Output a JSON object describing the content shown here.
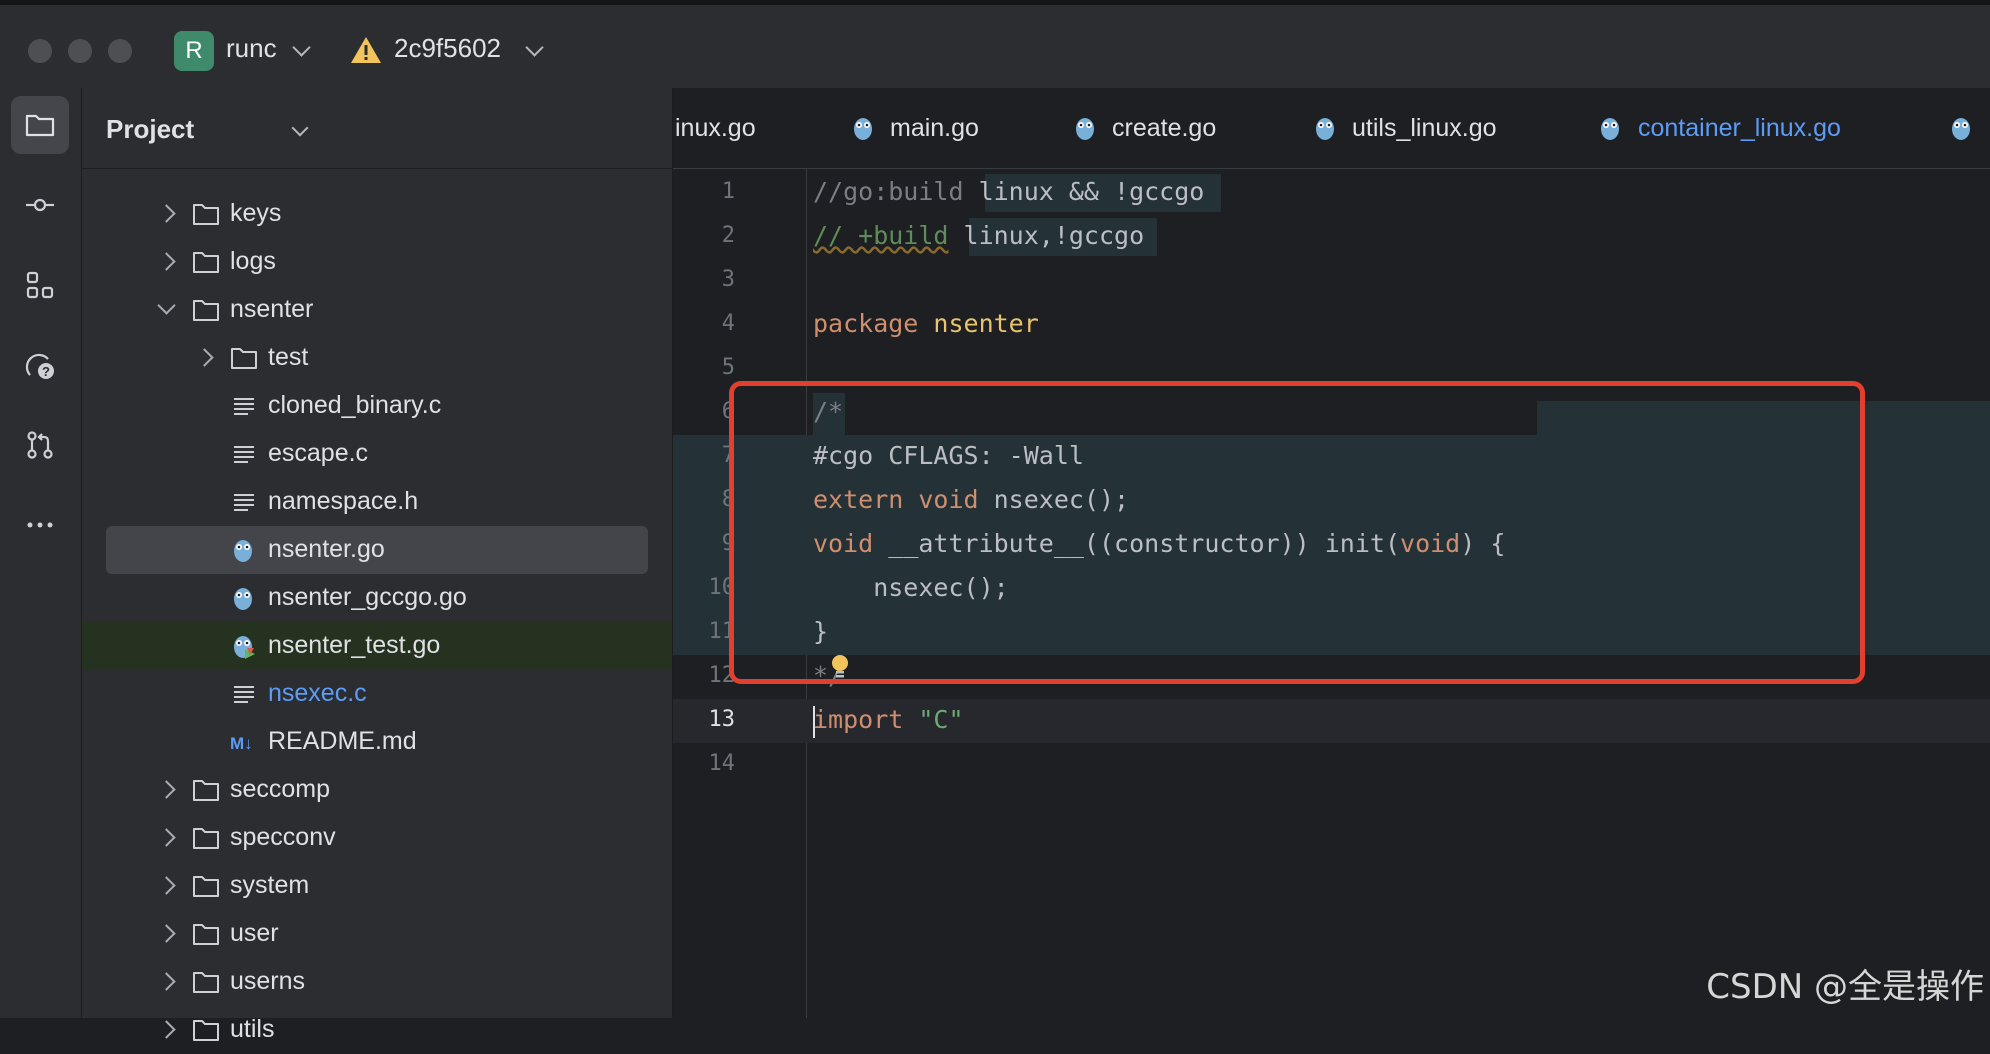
{
  "window": {
    "project_badge": "R",
    "project_name": "runc",
    "commit": "2c9f5602"
  },
  "toolstrip": {
    "icons": [
      "project-folder-icon",
      "commit-icon",
      "structure-icon",
      "services-icon",
      "pull-requests-icon",
      "more-icon"
    ]
  },
  "project_panel": {
    "title": "Project",
    "items": [
      {
        "label": "keys",
        "type": "folder",
        "expanded": false
      },
      {
        "label": "logs",
        "type": "folder",
        "expanded": false
      },
      {
        "label": "nsenter",
        "type": "folder",
        "expanded": true
      },
      {
        "label": "test",
        "type": "folder",
        "expanded": false
      },
      {
        "label": "cloned_binary.c",
        "type": "c-file"
      },
      {
        "label": "escape.c",
        "type": "c-file"
      },
      {
        "label": "namespace.h",
        "type": "c-file"
      },
      {
        "label": "nsenter.go",
        "type": "go-file",
        "selected": true
      },
      {
        "label": "nsenter_gccgo.go",
        "type": "go-file"
      },
      {
        "label": "nsenter_test.go",
        "type": "go-test-file"
      },
      {
        "label": "nsexec.c",
        "type": "c-file",
        "modified": true
      },
      {
        "label": "README.md",
        "type": "md-file",
        "icon_text": "M↓"
      },
      {
        "label": "seccomp",
        "type": "folder",
        "expanded": false
      },
      {
        "label": "specconv",
        "type": "folder",
        "expanded": false
      },
      {
        "label": "system",
        "type": "folder",
        "expanded": false
      },
      {
        "label": "user",
        "type": "folder",
        "expanded": false
      },
      {
        "label": "userns",
        "type": "folder",
        "expanded": false
      },
      {
        "label": "utils",
        "type": "folder",
        "expanded": false
      }
    ]
  },
  "tabs": [
    {
      "label": "inux.go"
    },
    {
      "label": "main.go"
    },
    {
      "label": "create.go"
    },
    {
      "label": "utils_linux.go"
    },
    {
      "label": "container_linux.go",
      "active": true
    }
  ],
  "editor": {
    "line_numbers": [
      "1",
      "2",
      "3",
      "4",
      "5",
      "6",
      "7",
      "8",
      "9",
      "10",
      "11",
      "12",
      "13",
      "14"
    ],
    "current_line": "13",
    "lines": {
      "l1_a": "//go:build",
      "l1_b": " linux && !gccgo",
      "l2_a": "// +build",
      "l2_b": " linux,!gccgo",
      "l4_a": "package",
      "l4_b": " nsenter",
      "l6": "/*",
      "l7": "#cgo CFLAGS: -Wall",
      "l8_a": "extern void",
      "l8_b": " nsexec();",
      "l9_a": "void",
      "l9_b": " __attribute__((constructor)) init(",
      "l9_c": "void",
      "l9_d": ") {",
      "l10": "    nsexec();",
      "l11": "}",
      "l12": "*/",
      "l13_a": "import",
      "l13_b": " \"C\""
    }
  },
  "watermark": "CSDN @全是操作"
}
